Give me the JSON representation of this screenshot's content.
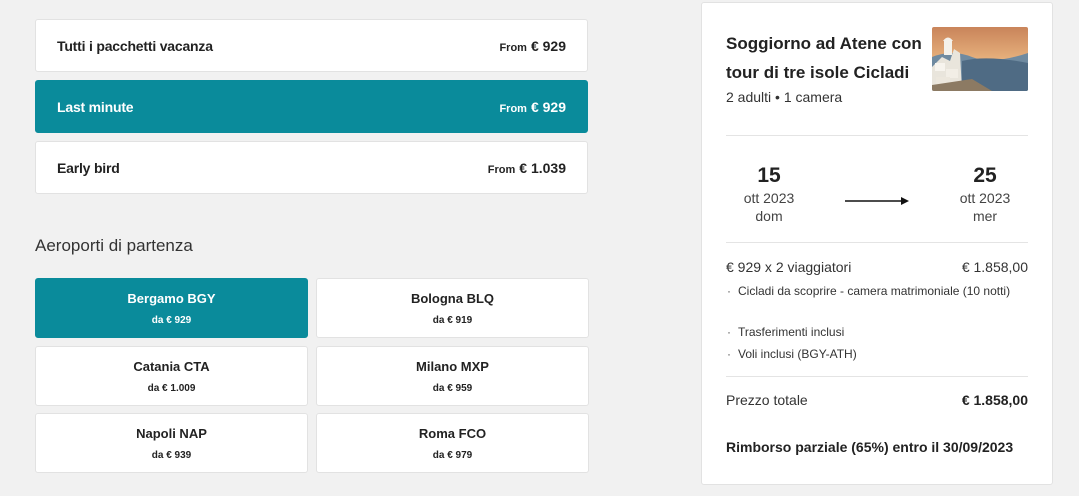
{
  "packages": [
    {
      "name": "Tutti i pacchetti vacanza",
      "from": "From",
      "price": "€ 929"
    },
    {
      "name": "Last minute",
      "from": "From",
      "price": "€ 929"
    },
    {
      "name": "Early bird",
      "from": "From",
      "price": "€ 1.039"
    }
  ],
  "departure": {
    "title": "Aeroporti di partenza",
    "airports": [
      {
        "name": "Bergamo BGY",
        "price": "da € 929"
      },
      {
        "name": "Bologna BLQ",
        "price": "da € 919"
      },
      {
        "name": "Catania CTA",
        "price": "da € 1.009"
      },
      {
        "name": "Milano MXP",
        "price": "da € 959"
      },
      {
        "name": "Napoli NAP",
        "price": "da € 939"
      },
      {
        "name": "Roma FCO",
        "price": "da € 979"
      }
    ]
  },
  "summary": {
    "title": "Soggiorno ad Atene con tour di tre isole Cicladi",
    "guests": "2 adulti • 1 camera",
    "checkin": {
      "day": "15",
      "month_year": "ott 2023",
      "weekday": "dom"
    },
    "checkout": {
      "day": "25",
      "month_year": "ott 2023",
      "weekday": "mer"
    },
    "price_line": {
      "label": "€ 929 x 2 viaggiatori",
      "value": "€ 1.858,00"
    },
    "inclusions": [
      "Cicladi da scoprire - camera matrimoniale (10 notti)",
      "Trasferimenti inclusi",
      "Voli inclusi (BGY-ATH)"
    ],
    "bullet": "·",
    "total": {
      "label": "Prezzo totale",
      "value": "€ 1.858,00"
    },
    "refund": "Rimborso parziale (65%) entro il 30/09/2023"
  },
  "colors": {
    "accent": "#0a8b9b"
  }
}
